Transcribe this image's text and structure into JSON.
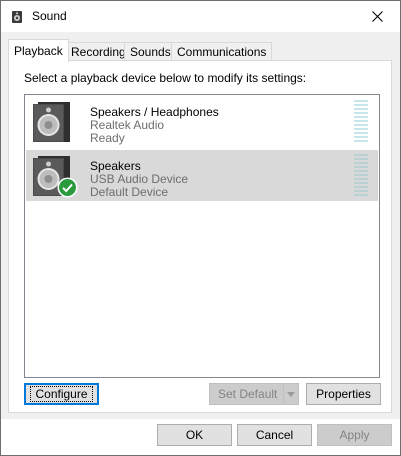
{
  "window": {
    "title": "Sound",
    "icon": "speaker-icon"
  },
  "tabs": [
    {
      "label": "Playback",
      "active": true
    },
    {
      "label": "Recording",
      "active": false
    },
    {
      "label": "Sounds",
      "active": false
    },
    {
      "label": "Communications",
      "active": false
    }
  ],
  "playback": {
    "instruction": "Select a playback device below to modify its settings:",
    "devices": [
      {
        "name": "Speakers / Headphones",
        "driver": "Realtek Audio",
        "status": "Ready",
        "selected": false,
        "default": false
      },
      {
        "name": "Speakers",
        "driver": "USB Audio Device",
        "status": "Default Device",
        "selected": true,
        "default": true
      }
    ]
  },
  "buttons": {
    "configure": "Configure",
    "set_default": "Set Default",
    "properties": "Properties",
    "ok": "OK",
    "cancel": "Cancel",
    "apply": "Apply"
  },
  "colors": {
    "accent": "#0078d7",
    "default_check": "#2b9a3e",
    "meter": "#c7e6ea",
    "selection": "#d9d9d9"
  }
}
